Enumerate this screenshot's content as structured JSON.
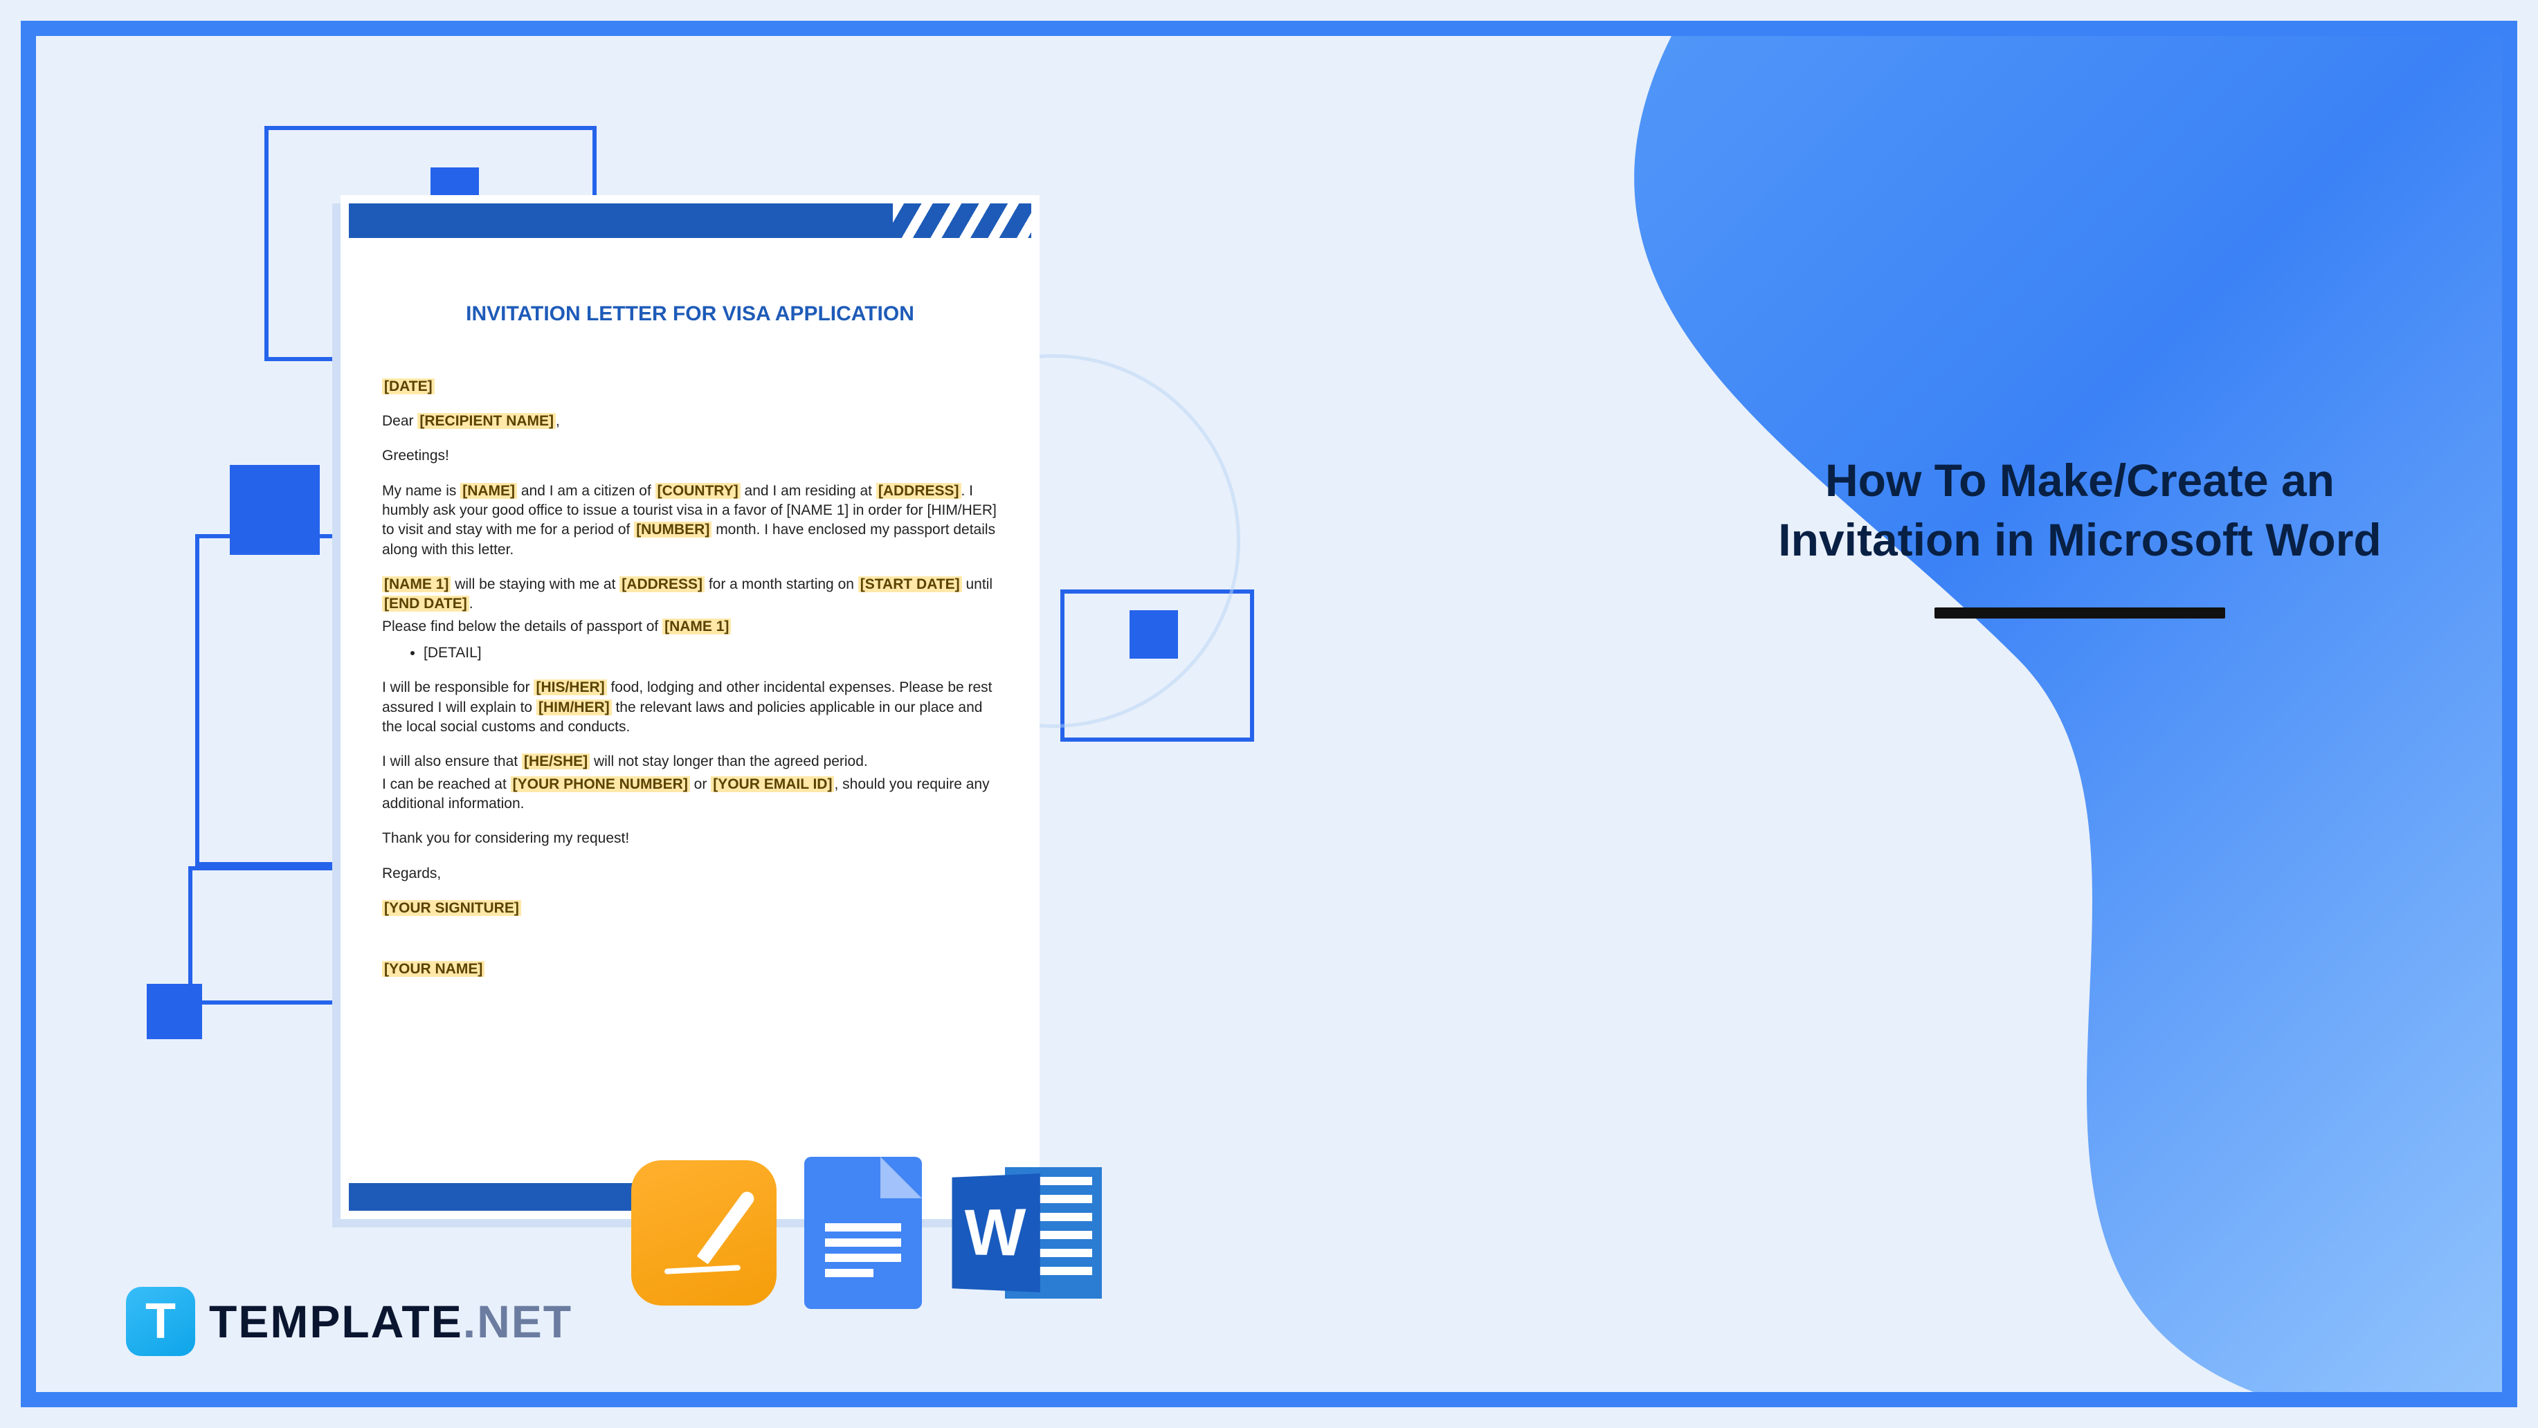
{
  "title": {
    "line1": "How To Make/Create an",
    "line2": "Invitation in Microsoft Word"
  },
  "brand": {
    "icon_letter": "T",
    "name": "TEMPLATE",
    "suffix": ".NET"
  },
  "apps": {
    "word_letter": "W"
  },
  "document": {
    "heading": "INVITATION LETTER FOR VISA APPLICATION",
    "date_placeholder": "[DATE]",
    "dear": "Dear",
    "recipient": "[RECIPIENT NAME]",
    "greeting": "Greetings!",
    "p1_pre": "My name is",
    "p1_name": "[NAME]",
    "p1_mid1": "and I am a citizen of",
    "p1_country": "[COUNTRY]",
    "p1_mid2": "and I am residing at",
    "p1_address": "[ADDRESS]",
    "p1_tail": ". I humbly ask your good office to issue a tourist visa in a favor of [NAME 1] in order for [HIM/HER] to visit and stay with me for a period of",
    "p1_number": "[NUMBER]",
    "p1_end": "month. I have enclosed my passport details along with this letter.",
    "p2_name1": "[NAME 1]",
    "p2_mid": "will be staying with me at",
    "p2_addr": "[ADDRESS]",
    "p2_mid2": "for a month starting on",
    "p2_start": "[START DATE]",
    "p2_until": "until",
    "p2_end": "[END DATE]",
    "p2_period": ".",
    "p3": "Please find below the details of passport of",
    "p3_name": "[NAME 1]",
    "detail_item": "[DETAIL]",
    "p4_pre": "I will be responsible for",
    "p4_hisher": "[HIS/HER]",
    "p4_mid": "food, lodging and other incidental expenses. Please be rest assured I will explain to",
    "p4_himher": "[HIM/HER]",
    "p4_end": "the relevant laws and policies applicable in our place and the local social customs and conducts.",
    "p5_pre": "I will also ensure that",
    "p5_heshe": "[HE/SHE]",
    "p5_end": "will not stay longer than the agreed period.",
    "p6_pre": "I can be reached at",
    "p6_phone": "[YOUR PHONE NUMBER]",
    "p6_or": "or",
    "p6_email": "[YOUR EMAIL ID]",
    "p6_end": ", should you require any additional information.",
    "thanks": "Thank you for considering my request!",
    "regards": "Regards,",
    "signature": "[YOUR SIGNITURE]",
    "your_name": "[YOUR NAME]"
  }
}
